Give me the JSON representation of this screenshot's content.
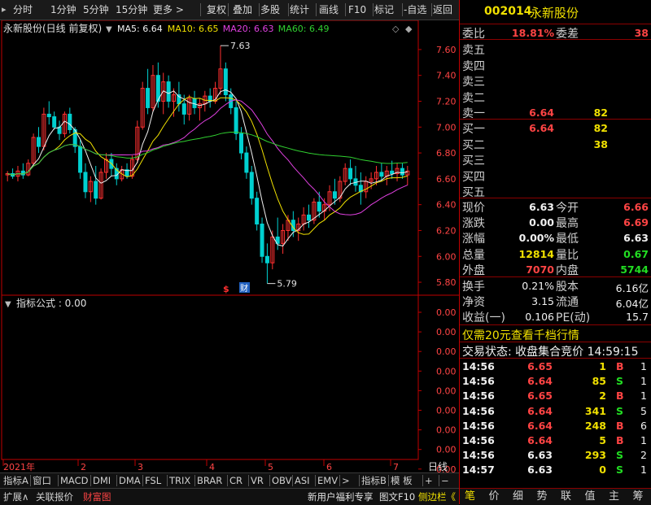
{
  "toolbar": {
    "items": [
      "分时",
      "1分钟",
      "5分钟",
      "15分钟",
      "更多 >",
      "复权",
      "叠加",
      "多股",
      "统计",
      "画线",
      "F10",
      "标记",
      "-自选",
      "返回"
    ]
  },
  "chart": {
    "stock_title": "永新股份(日线 前复权)",
    "ma_labels": [
      {
        "text": "MA5: 6.64",
        "color": "#f0f0f0"
      },
      {
        "text": "MA10: 6.65",
        "color": "#f0e000"
      },
      {
        "text": "MA20: 6.63",
        "color": "#e040e0"
      },
      {
        "text": "MA60: 6.49",
        "color": "#30d030"
      }
    ],
    "price_axis": [
      "7.60",
      "7.40",
      "7.20",
      "7.00",
      "6.80",
      "6.60",
      "6.40",
      "6.20",
      "6.00",
      "5.80"
    ],
    "high_marker": "7.63",
    "low_marker": "5.79",
    "markers": {
      "s": "$",
      "cai": "财"
    },
    "indicator_title": "指标公式 : 0.00",
    "indicator_axis": [
      "0.00",
      "0.00",
      "0.00",
      "0.00",
      "0.00",
      "0.00",
      "0.00",
      "0.00",
      "0.00",
      "0.00"
    ],
    "date_axis": [
      "2021年",
      "2",
      "3",
      "4",
      "5",
      "6",
      "7"
    ],
    "date_axis_label": "日线"
  },
  "chart_data": {
    "type": "candlestick",
    "ylim": [
      5.75,
      7.7
    ],
    "candles": [
      [
        6.63,
        6.66,
        6.58,
        6.64
      ],
      [
        6.64,
        6.68,
        6.6,
        6.62
      ],
      [
        6.62,
        6.7,
        6.58,
        6.66
      ],
      [
        6.66,
        6.72,
        6.6,
        6.63
      ],
      [
        6.63,
        6.75,
        6.62,
        6.72
      ],
      [
        6.72,
        6.95,
        6.7,
        6.92
      ],
      [
        6.92,
        7.0,
        6.8,
        6.85
      ],
      [
        6.85,
        7.15,
        6.82,
        7.1
      ],
      [
        7.1,
        7.2,
        7.02,
        7.08
      ],
      [
        7.08,
        7.12,
        6.98,
        7.0
      ],
      [
        7.0,
        7.05,
        6.9,
        6.95
      ],
      [
        6.95,
        7.12,
        6.92,
        7.1
      ],
      [
        7.1,
        7.15,
        6.95,
        6.98
      ],
      [
        6.98,
        7.0,
        6.8,
        6.85
      ],
      [
        6.85,
        6.9,
        6.6,
        6.65
      ],
      [
        6.65,
        6.72,
        6.45,
        6.5
      ],
      [
        6.5,
        6.62,
        6.42,
        6.58
      ],
      [
        6.58,
        6.7,
        6.4,
        6.45
      ],
      [
        6.45,
        6.68,
        6.44,
        6.65
      ],
      [
        6.65,
        6.8,
        6.6,
        6.75
      ],
      [
        6.75,
        6.8,
        6.62,
        6.68
      ],
      [
        6.68,
        6.72,
        6.55,
        6.6
      ],
      [
        6.6,
        6.7,
        6.58,
        6.67
      ],
      [
        6.67,
        6.72,
        6.6,
        6.62
      ],
      [
        6.62,
        6.78,
        6.6,
        6.75
      ],
      [
        6.75,
        7.05,
        6.72,
        7.0
      ],
      [
        7.0,
        7.35,
        6.98,
        7.3
      ],
      [
        7.3,
        7.45,
        7.1,
        7.15
      ],
      [
        7.15,
        7.48,
        7.12,
        7.4
      ],
      [
        7.4,
        7.5,
        7.15,
        7.2
      ],
      [
        7.2,
        7.42,
        7.1,
        7.35
      ],
      [
        7.35,
        7.4,
        7.15,
        7.2
      ],
      [
        7.2,
        7.3,
        7.08,
        7.25
      ],
      [
        7.25,
        7.35,
        7.12,
        7.18
      ],
      [
        7.18,
        7.25,
        7.02,
        7.1
      ],
      [
        7.1,
        7.25,
        7.05,
        7.22
      ],
      [
        7.22,
        7.28,
        7.1,
        7.15
      ],
      [
        7.15,
        7.22,
        7.05,
        7.18
      ],
      [
        7.18,
        7.28,
        7.12,
        7.24
      ],
      [
        7.24,
        7.3,
        7.15,
        7.2
      ],
      [
        7.2,
        7.35,
        7.18,
        7.3
      ],
      [
        7.3,
        7.63,
        7.25,
        7.45
      ],
      [
        7.45,
        7.5,
        7.2,
        7.25
      ],
      [
        7.25,
        7.3,
        7.1,
        7.15
      ],
      [
        7.15,
        7.2,
        6.9,
        6.95
      ],
      [
        6.95,
        7.0,
        6.75,
        6.8
      ],
      [
        6.8,
        6.85,
        6.6,
        6.65
      ],
      [
        6.65,
        6.7,
        6.4,
        6.45
      ],
      [
        6.45,
        6.5,
        6.2,
        6.25
      ],
      [
        6.25,
        6.3,
        5.95,
        6.0
      ],
      [
        6.0,
        6.1,
        5.79,
        5.95
      ],
      [
        5.95,
        6.2,
        5.9,
        6.15
      ],
      [
        6.15,
        6.3,
        6.05,
        6.1
      ],
      [
        6.1,
        6.25,
        6.02,
        6.2
      ],
      [
        6.2,
        6.32,
        6.12,
        6.28
      ],
      [
        6.28,
        6.35,
        6.15,
        6.2
      ],
      [
        6.2,
        6.3,
        6.12,
        6.25
      ],
      [
        6.25,
        6.38,
        6.2,
        6.32
      ],
      [
        6.32,
        6.4,
        6.22,
        6.28
      ],
      [
        6.28,
        6.45,
        6.25,
        6.42
      ],
      [
        6.42,
        6.5,
        6.3,
        6.35
      ],
      [
        6.35,
        6.45,
        6.28,
        6.4
      ],
      [
        6.4,
        6.55,
        6.35,
        6.5
      ],
      [
        6.5,
        6.6,
        6.4,
        6.45
      ],
      [
        6.45,
        6.62,
        6.42,
        6.58
      ],
      [
        6.58,
        6.72,
        6.55,
        6.68
      ],
      [
        6.68,
        6.75,
        6.55,
        6.6
      ],
      [
        6.6,
        6.7,
        6.5,
        6.55
      ],
      [
        6.55,
        6.65,
        6.4,
        6.5
      ],
      [
        6.5,
        6.62,
        6.45,
        6.58
      ],
      [
        6.58,
        6.65,
        6.52,
        6.6
      ],
      [
        6.6,
        6.7,
        6.55,
        6.65
      ],
      [
        6.65,
        6.72,
        6.58,
        6.62
      ],
      [
        6.62,
        6.7,
        6.55,
        6.66
      ],
      [
        6.66,
        6.74,
        6.6,
        6.64
      ],
      [
        6.64,
        6.72,
        6.58,
        6.68
      ],
      [
        6.68,
        6.72,
        6.6,
        6.63
      ],
      [
        6.63,
        6.7,
        6.55,
        6.66
      ]
    ]
  },
  "tabs": [
    "指标A",
    "窗口",
    "MACD",
    "DMI",
    "DMA",
    "FSL",
    "TRIX",
    "BRAR",
    "CR",
    "VR",
    "OBV",
    "ASI",
    "EMV",
    ">",
    "指标B",
    "模 板",
    "+",
    "−"
  ],
  "statusbar": {
    "left": [
      "扩展∧",
      "关联报价",
      "财富图"
    ],
    "right": [
      "新用户福利专享",
      "图文F10",
      "侧边栏《"
    ]
  },
  "panel": {
    "code": "002014",
    "name": "永新股份",
    "weibi_label": "委比",
    "weibi_val": "18.81%",
    "weicha_label": "委差",
    "weicha_val": "38",
    "sell": [
      {
        "label": "卖五",
        "price": "",
        "vol": ""
      },
      {
        "label": "卖四",
        "price": "",
        "vol": ""
      },
      {
        "label": "卖三",
        "price": "",
        "vol": ""
      },
      {
        "label": "卖二",
        "price": "",
        "vol": ""
      },
      {
        "label": "卖一",
        "price": "6.64",
        "vol": "82"
      }
    ],
    "buy": [
      {
        "label": "买一",
        "price": "6.64",
        "vol": "82"
      },
      {
        "label": "买二",
        "price": "",
        "vol": "38"
      },
      {
        "label": "买三",
        "price": "",
        "vol": ""
      },
      {
        "label": "买四",
        "price": "",
        "vol": ""
      },
      {
        "label": "买五",
        "price": "",
        "vol": ""
      }
    ],
    "stats": [
      {
        "l1": "现价",
        "v1": "6.63",
        "c1": "wht",
        "l2": "今开",
        "v2": "6.66",
        "c2": "red"
      },
      {
        "l1": "涨跌",
        "v1": "0.00",
        "c1": "wht",
        "l2": "最高",
        "v2": "6.69",
        "c2": "red"
      },
      {
        "l1": "涨幅",
        "v1": "0.00%",
        "c1": "wht",
        "l2": "最低",
        "v2": "6.63",
        "c2": "wht"
      },
      {
        "l1": "总量",
        "v1": "12814",
        "c1": "yel",
        "l2": "量比",
        "v2": "0.67",
        "c2": "grn"
      },
      {
        "l1": "外盘",
        "v1": "7070",
        "c1": "red",
        "l2": "内盘",
        "v2": "5744",
        "c2": "grn"
      }
    ],
    "stats2": [
      {
        "l1": "换手",
        "v1": "0.21%",
        "l2": "股本",
        "v2": "6.16亿"
      },
      {
        "l1": "净资",
        "v1": "3.15",
        "l2": "流通",
        "v2": "6.04亿"
      },
      {
        "l1": "收益(一)",
        "v1": "0.106",
        "l2": "PE(动)",
        "v2": "15.7"
      }
    ],
    "promo": "仅需20元查看千档行情",
    "trade_status": "交易状态: 收盘集合竞价 14:59:15",
    "ticks": [
      {
        "time": "14:56",
        "price": "6.65",
        "pc": "red",
        "vol": "1",
        "vc": "yel",
        "side": "B",
        "sc": "red",
        "n": "1"
      },
      {
        "time": "14:56",
        "price": "6.64",
        "pc": "red",
        "vol": "85",
        "vc": "yel",
        "side": "S",
        "sc": "grn",
        "n": "1"
      },
      {
        "time": "14:56",
        "price": "6.65",
        "pc": "red",
        "vol": "2",
        "vc": "yel",
        "side": "B",
        "sc": "red",
        "n": "1"
      },
      {
        "time": "14:56",
        "price": "6.64",
        "pc": "red",
        "vol": "341",
        "vc": "yel",
        "side": "S",
        "sc": "grn",
        "n": "5"
      },
      {
        "time": "14:56",
        "price": "6.64",
        "pc": "red",
        "vol": "248",
        "vc": "yel",
        "side": "B",
        "sc": "red",
        "n": "6"
      },
      {
        "time": "14:56",
        "price": "6.64",
        "pc": "red",
        "vol": "5",
        "vc": "yel",
        "side": "B",
        "sc": "red",
        "n": "1"
      },
      {
        "time": "14:56",
        "price": "6.63",
        "pc": "wht",
        "vol": "293",
        "vc": "yel",
        "side": "S",
        "sc": "grn",
        "n": "2"
      },
      {
        "time": "14:57",
        "price": "6.63",
        "pc": "wht",
        "vol": "0",
        "vc": "yel",
        "side": "S",
        "sc": "grn",
        "n": "1"
      }
    ],
    "bottom_tabs": [
      "笔",
      "价",
      "细",
      "势",
      "联",
      "值",
      "主",
      "筹"
    ]
  }
}
